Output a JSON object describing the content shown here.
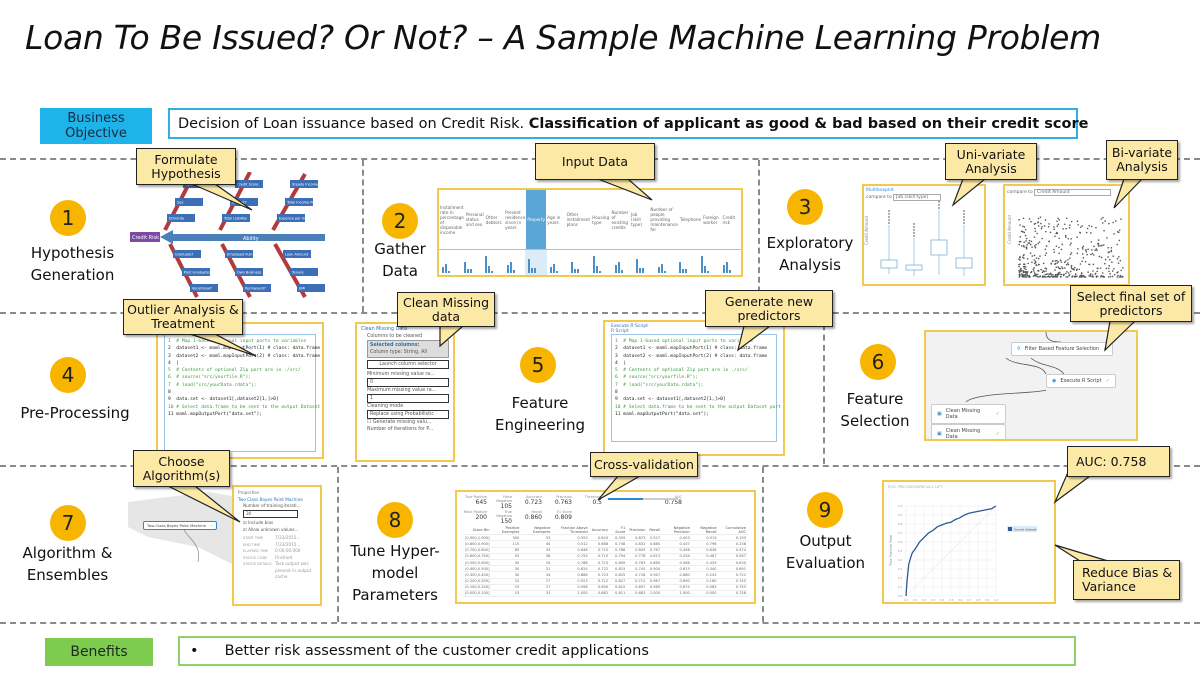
{
  "title": "Loan To Be Issued? Or Not? – A Sample Machine Learning Problem",
  "business_objective": {
    "tag": "Business Objective",
    "text_plain": "Decision of Loan issuance based on Credit Risk. ",
    "text_bold": "Classification of applicant as good & bad based on their credit score"
  },
  "benefits": {
    "tag": "Benefits",
    "bullet": "•",
    "text": "Better risk assessment of the customer credit applications"
  },
  "steps": [
    {
      "num": "1",
      "label": "Hypothesis Generation"
    },
    {
      "num": "2",
      "label": "Gather Data"
    },
    {
      "num": "3",
      "label": "Exploratory Analysis"
    },
    {
      "num": "4",
      "label": "Pre-Processing"
    },
    {
      "num": "5",
      "label": "Feature Engineering"
    },
    {
      "num": "6",
      "label": "Feature Selection"
    },
    {
      "num": "7",
      "label": "Algorithm & Ensembles"
    },
    {
      "num": "8",
      "label": "Tune Hyper-model Parameters"
    },
    {
      "num": "9",
      "label": "Output Evaluation"
    }
  ],
  "callouts": {
    "formulate": "Formulate Hypothesis",
    "input": "Input Data",
    "uni": "Uni-variate Analysis",
    "bi": "Bi-variate Analysis",
    "outlier": "Outlier Analysis & Treatment",
    "clean": "Clean Missing data",
    "generate": "Generate new predictors",
    "select": "Select final set of predictors",
    "choose": "Choose Algorithm(s)",
    "cv": "Cross-validation",
    "auc": "AUC: 0.758",
    "bias": "Reduce Bias & Variance"
  },
  "fishbone": {
    "head": "Credit Risk",
    "spine": "Ability",
    "boxes": [
      "Age",
      "Credit Score",
      "Steady Income?",
      "Sex",
      "Default?",
      "Total Income Per month",
      "Ethnicity",
      "Total Liability",
      "Expense per month",
      "Graduate?",
      "Employed Full-time?",
      "Loan Amount",
      "Post Graduate?",
      "Own Business",
      "Tenure",
      "Vocational?",
      "Permanent?",
      "EMI"
    ]
  },
  "input_table": {
    "columns": [
      "Installment rate in percentage of disposable income",
      "Personal status and sex",
      "Other debtors",
      "Present residence since in years",
      "Property",
      "Age in years",
      "Other installment plans",
      "Housing type",
      "Number of existing credits",
      "Job (skill type)",
      "Number of people providing maintenance for",
      "Telephone",
      "Foreign worker",
      "Credit risk"
    ],
    "highlighted": "Property"
  },
  "uni": {
    "header": "Multiboxplot",
    "compare": "compare to",
    "select": "Job (skill type)",
    "ylabel": "Credit Amount"
  },
  "bi": {
    "compare": "compare to",
    "select": "Credit Amount",
    "ylabel": "Credit Amount"
  },
  "rscript": {
    "title": "Execute R Script",
    "sub": "R Script",
    "lines": [
      "1  # Map 1-based optional input ports to variables",
      "2  dataset1 <- maml.mapInputPort(1) # class: data.frame",
      "3  dataset2 <- maml.mapInputPort(2) # class: data.frame",
      "4  |",
      "5  # Contents of optional Zip port are in ./src/",
      "6  # source(\"src/yourfile.R\");",
      "7  # load(\"src/yourData.rdata\");",
      "8",
      "9  data.set <- dataset1[,dataset2[1,]>0]",
      "10 # Select data.frame to be sent to the output Dataset port",
      "11 maml.mapOutputPort(\"data.set\");"
    ]
  },
  "clean_missing": {
    "title": "Clean Missing Data",
    "cols": "Columns to be cleaned",
    "selected": "Selected columns:",
    "type": "Column type: String, All",
    "launch": "Launch column selector",
    "min_label": "Minimum missing value ra...",
    "min": "0",
    "max_label": "Maximum missing value ra...",
    "max": "1",
    "mode_label": "Cleaning mode",
    "mode": "Replace using Probabilistic",
    "gen": "Generate missing valu...",
    "iter": "Number of iterations for P..."
  },
  "feature_sel": {
    "nodes": [
      "Filter Based Feature Selection",
      "Execute R Script",
      "Clean Missing Data",
      "Clean Missing Data"
    ]
  },
  "algo": {
    "node": "Two-Class Bayes Point Machine",
    "props": "Properties",
    "module": "Two Class Bayes Point Machine",
    "iters_label": "Number of training iterati...",
    "iters": "30",
    "bias": "Include bias",
    "unknown": "Allow unknown values...",
    "meta": [
      [
        "START TIME",
        "7/23/2015..."
      ],
      [
        "END TIME",
        "7/23/2015..."
      ],
      [
        "ELAPSED TIME",
        "0:00:00.000"
      ],
      [
        "STATUS CODE",
        "Finished"
      ],
      [
        "STATUS DETAILS",
        "Task output was present in output cache"
      ]
    ]
  },
  "tune": {
    "metrics": [
      [
        "True Positive",
        "645"
      ],
      [
        "False Negative",
        "105"
      ],
      [
        "Accuracy",
        "0.723"
      ],
      [
        "Precision",
        "0.763"
      ],
      [
        "Threshold",
        "0.5"
      ],
      [
        "AUC",
        "0.758"
      ],
      [
        "False Positive",
        "200"
      ],
      [
        "True Negative",
        "150"
      ],
      [
        "Recall",
        "0.860"
      ],
      [
        "F1 Score",
        "0.809"
      ]
    ],
    "threshold": 0.5,
    "headers": [
      "Score Bin",
      "Positive Examples",
      "Negative Examples",
      "Fraction Above Threshold",
      "Accuracy",
      "F1 Score",
      "Precision",
      "Recall",
      "Negative Precision",
      "Negative Recall",
      "Cumulative AUC"
    ],
    "rows": [
      [
        "(0.900,1.000]",
        "300",
        "53",
        "0.353",
        "0.624",
        "0.559",
        "0.873",
        "0.527",
        "0.403",
        "0.913",
        "0.193"
      ],
      [
        "(0.800,0.900]",
        "115",
        "44",
        "0.512",
        "0.688",
        "0.748",
        "0.832",
        "0.680",
        "0.437",
        "0.796",
        "0.338"
      ],
      [
        "(0.700,0.800]",
        "69",
        "33",
        "0.648",
        "0.715",
        "0.788",
        "0.809",
        "0.767",
        "0.458",
        "0.636",
        "0.474"
      ],
      [
        "(0.600,0.700]",
        "55",
        "36",
        "0.755",
        "0.715",
        "0.794",
        "0.778",
        "0.813",
        "0.534",
        "0.487",
        "0.567"
      ],
      [
        "(0.500,0.600]",
        "35",
        "24",
        "0.788",
        "0.723",
        "0.809",
        "0.763",
        "0.860",
        "0.588",
        "0.429",
        "0.630"
      ],
      [
        "(0.400,0.500]",
        "30",
        "31",
        "0.824",
        "0.722",
        "0.815",
        "0.745",
        "0.900",
        "0.615",
        "0.340",
        "0.691"
      ],
      [
        "(0.300,0.400]",
        "30",
        "34",
        "0.888",
        "0.723",
        "0.825",
        "0.728",
        "0.947",
        "0.680",
        "0.243",
        "0.722"
      ],
      [
        "(0.200,0.300]",
        "15",
        "27",
        "0.923",
        "0.712",
        "0.827",
        "0.712",
        "0.967",
        "0.690",
        "0.180",
        "0.745"
      ],
      [
        "(0.100,0.200]",
        "15",
        "27",
        "0.958",
        "0.690",
        "0.815",
        "0.697",
        "0.985",
        "0.674",
        "0.083",
        "0.755"
      ],
      [
        "(0.000,0.100]",
        "15",
        "31",
        "1.000",
        "0.682",
        "0.811",
        "0.682",
        "1.000",
        "1.000",
        "0.000",
        "0.758"
      ]
    ]
  },
  "roc": {
    "tabs": "ROC  PRECISION/RECALL  LIFT",
    "ylabel": "True Positive Rate",
    "legend": "Scored dataset",
    "color": "#2f5a96",
    "fpr": [
      0,
      0.01,
      0.02,
      0.03,
      0.05,
      0.07,
      0.1,
      0.12,
      0.15,
      0.2,
      0.25,
      0.3,
      0.35,
      0.4,
      0.45,
      0.5,
      0.55,
      0.6,
      0.65,
      0.7,
      0.75,
      0.8,
      0.85,
      0.9,
      0.95,
      1.0
    ],
    "tpr": [
      0,
      0.15,
      0.25,
      0.35,
      0.42,
      0.48,
      0.52,
      0.55,
      0.6,
      0.65,
      0.7,
      0.73,
      0.77,
      0.79,
      0.81,
      0.82,
      0.85,
      0.87,
      0.9,
      0.92,
      0.93,
      0.94,
      0.95,
      0.96,
      0.97,
      1.0
    ],
    "ticks": [
      "0.0",
      "0.1",
      "0.2",
      "0.3",
      "0.4",
      "0.5",
      "0.6",
      "0.7",
      "0.8",
      "0.9",
      "1.0"
    ]
  },
  "colors": {
    "step_circle": "#f7b500",
    "callout": "#fde9a6",
    "thumb_border": "#f2c94c",
    "objective": "#1eb4ea",
    "benefits": "#7dcb4f"
  }
}
